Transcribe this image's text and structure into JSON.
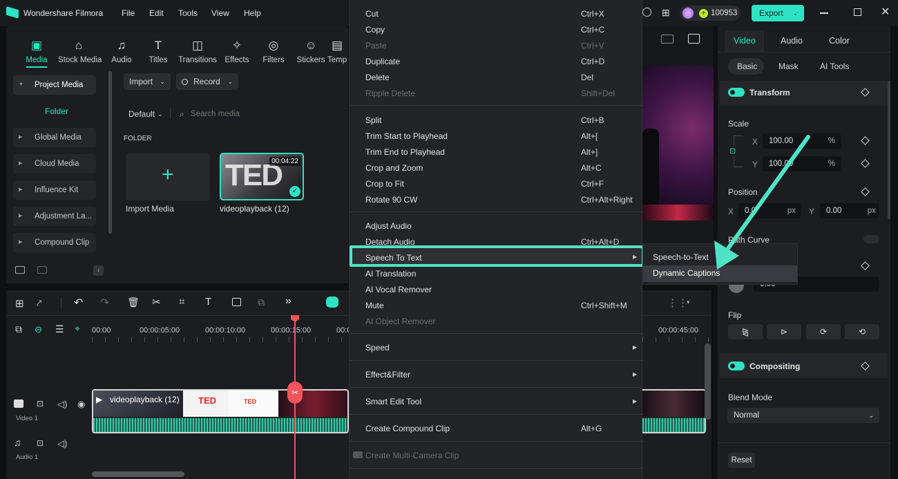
{
  "app": {
    "title": "Wondershare Filmora"
  },
  "menu": [
    "File",
    "Edit",
    "Tools",
    "View",
    "Help"
  ],
  "header": {
    "credits": "100953",
    "export_label": "Export"
  },
  "toolbar": {
    "tabs": [
      {
        "label": "Media",
        "icon": "media-icon",
        "active": true
      },
      {
        "label": "Stock Media",
        "icon": "stock-media-icon"
      },
      {
        "label": "Audio",
        "icon": "music-icon"
      },
      {
        "label": "Titles",
        "icon": "titles-icon"
      },
      {
        "label": "Transitions",
        "icon": "transitions-icon"
      },
      {
        "label": "Effects",
        "icon": "effects-icon"
      },
      {
        "label": "Filters",
        "icon": "filters-icon"
      },
      {
        "label": "Stickers",
        "icon": "stickers-icon"
      },
      {
        "label": "Temp",
        "icon": "templates-icon"
      }
    ]
  },
  "sidebar": {
    "items": [
      {
        "label": "Project Media"
      },
      {
        "label": "Folder"
      },
      {
        "label": "Global Media"
      },
      {
        "label": "Cloud Media"
      },
      {
        "label": "Influence Kit"
      },
      {
        "label": "Adjustment La..."
      },
      {
        "label": "Compound Clip"
      }
    ]
  },
  "media": {
    "import_label": "Import",
    "record_label": "Record",
    "sort_label": "Default",
    "search_placeholder": "Search media",
    "folder_heading": "FOLDER",
    "import_media_label": "Import Media",
    "clip_name": "videoplayback (12)",
    "clip_duration": "00:04:22",
    "clip_thumb_text": "TED"
  },
  "right_panel": {
    "tabs": [
      "Video",
      "Audio",
      "Color"
    ],
    "subtabs": [
      "Basic",
      "Mask",
      "AI Tools"
    ],
    "transform_label": "Transform",
    "scale_label": "Scale",
    "scale_x_label": "X",
    "scale_x": "100.00",
    "scale_y_label": "Y",
    "scale_y": "100.00",
    "percent": "%",
    "position_label": "Position",
    "pos_x_label": "X",
    "pos_x": "0.0",
    "pos_y_label": "Y",
    "pos_y": "0.00",
    "px": "px",
    "path_curve_label": "Path Curve",
    "rotate_value": "0.00",
    "flip_label": "Flip",
    "compositing_label": "Compositing",
    "blend_mode_label": "Blend Mode",
    "blend_mode_value": "Normal",
    "reset_label": "Reset"
  },
  "timeline": {
    "ruler": [
      "00:00",
      "00:00:05:00",
      "00:00:10:00",
      "00:00:15:00",
      "00:0",
      "00:00:45:00"
    ],
    "video_track_label": "Video 1",
    "audio_track_label": "Audio 1",
    "clip_label": "videoplayback (12)",
    "thumb_texts": [
      "TED",
      "TED"
    ]
  },
  "context_menu": {
    "groups": [
      [
        {
          "label": "Cut",
          "shortcut": "Ctrl+X"
        },
        {
          "label": "Copy",
          "shortcut": "Ctrl+C"
        },
        {
          "label": "Paste",
          "shortcut": "Ctrl+V",
          "disabled": true
        },
        {
          "label": "Duplicate",
          "shortcut": "Ctrl+D"
        },
        {
          "label": "Delete",
          "shortcut": "Del"
        },
        {
          "label": "Ripple Delete",
          "shortcut": "Shift+Del",
          "disabled": true
        }
      ],
      [
        {
          "label": "Split",
          "shortcut": "Ctrl+B"
        },
        {
          "label": "Trim Start to Playhead",
          "shortcut": "Alt+["
        },
        {
          "label": "Trim End to Playhead",
          "shortcut": "Alt+]"
        },
        {
          "label": "Crop and Zoom",
          "shortcut": "Alt+C"
        },
        {
          "label": "Crop to Fit",
          "shortcut": "Ctrl+F"
        },
        {
          "label": "Rotate 90 CW",
          "shortcut": "Ctrl+Alt+Right"
        }
      ],
      [
        {
          "label": "Adjust Audio",
          "shortcut": ""
        },
        {
          "label": "Detach Audio",
          "shortcut": "Ctrl+Alt+D"
        },
        {
          "label": "Speech To Text",
          "shortcut": "",
          "submenu": true,
          "highlighted": true
        },
        {
          "label": "AI Translation",
          "shortcut": ""
        },
        {
          "label": "AI Vocal Remover",
          "shortcut": ""
        },
        {
          "label": "Mute",
          "shortcut": "Ctrl+Shift+M"
        },
        {
          "label": "AI Object Remover",
          "shortcut": "",
          "disabled": true
        }
      ],
      [
        {
          "label": "Speed",
          "submenu": true
        }
      ],
      [
        {
          "label": "Effect&Filter",
          "submenu": true
        }
      ],
      [
        {
          "label": "Smart Edit Tool",
          "submenu": true
        }
      ],
      [
        {
          "label": "Create Compound Clip",
          "shortcut": "Alt+G"
        }
      ],
      [
        {
          "label": "Create Multi-Camera Clip",
          "shortcut": "",
          "disabled": true
        }
      ]
    ]
  },
  "submenu": {
    "items": [
      {
        "label": "Speech-to-Text"
      },
      {
        "label": "Dynamic Captions",
        "highlighted": true
      }
    ]
  },
  "colors": {
    "accent": "#2ee3c4",
    "highlight": "#4fe3c6",
    "playhead": "#f0545c"
  }
}
